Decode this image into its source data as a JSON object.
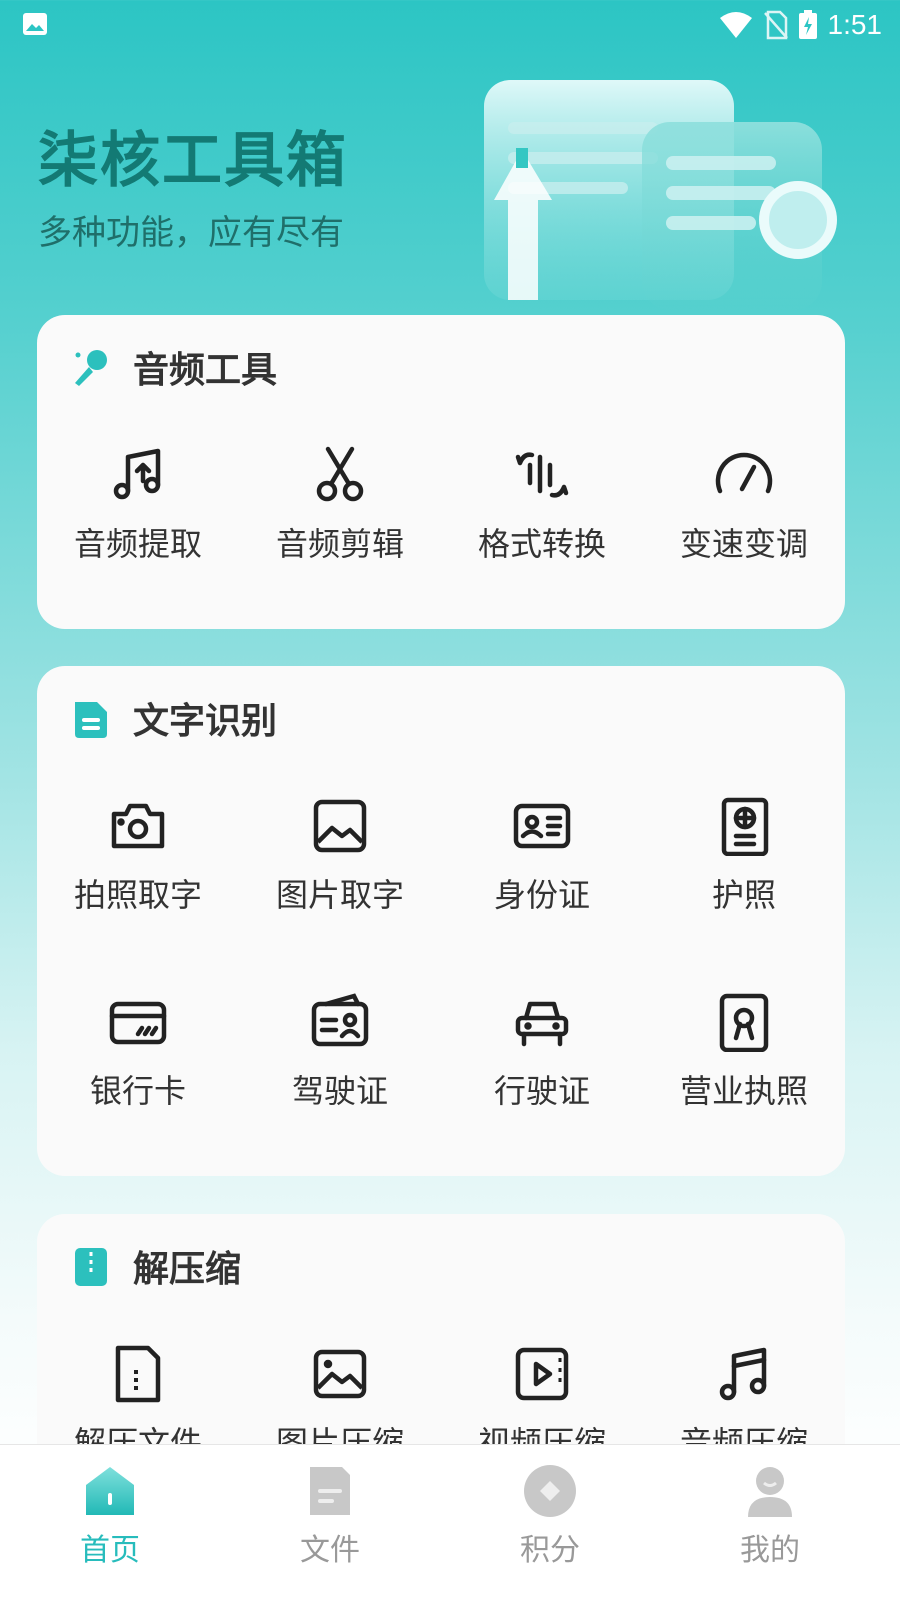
{
  "status_bar": {
    "time": "1:51"
  },
  "hero": {
    "title": "柒核工具箱",
    "subtitle": "多种功能，应有尽有"
  },
  "sections": [
    {
      "title": "音频工具",
      "icon": "microphone-icon",
      "items": [
        {
          "label": "音频提取",
          "icon": "music-upload-icon"
        },
        {
          "label": "音频剪辑",
          "icon": "scissors-icon"
        },
        {
          "label": "格式转换",
          "icon": "waveform-convert-icon"
        },
        {
          "label": "变速变调",
          "icon": "speedometer-icon"
        }
      ]
    },
    {
      "title": "文字识别",
      "icon": "document-icon",
      "items": [
        {
          "label": "拍照取字",
          "icon": "camera-icon"
        },
        {
          "label": "图片取字",
          "icon": "image-icon"
        },
        {
          "label": "身份证",
          "icon": "id-card-icon"
        },
        {
          "label": "护照",
          "icon": "passport-icon"
        },
        {
          "label": "银行卡",
          "icon": "bank-card-icon"
        },
        {
          "label": "驾驶证",
          "icon": "driver-license-icon"
        },
        {
          "label": "行驶证",
          "icon": "car-icon"
        },
        {
          "label": "营业执照",
          "icon": "business-license-icon"
        }
      ]
    },
    {
      "title": "解压缩",
      "icon": "zip-icon",
      "items": [
        {
          "label": "解压文件",
          "icon": "zip-file-icon"
        },
        {
          "label": "图片压缩",
          "icon": "image-compress-icon"
        },
        {
          "label": "视频压缩",
          "icon": "video-compress-icon"
        },
        {
          "label": "音频压缩",
          "icon": "music-note-icon"
        }
      ]
    }
  ],
  "tabbar": [
    {
      "label": "首页",
      "icon": "home-icon",
      "active": true
    },
    {
      "label": "文件",
      "icon": "file-icon",
      "active": false
    },
    {
      "label": "积分",
      "icon": "points-icon",
      "active": false
    },
    {
      "label": "我的",
      "icon": "user-icon",
      "active": false
    }
  ],
  "colors": {
    "accent": "#27bcbc",
    "title": "#137a74",
    "card": "#fafafa",
    "inactive": "#999999"
  }
}
